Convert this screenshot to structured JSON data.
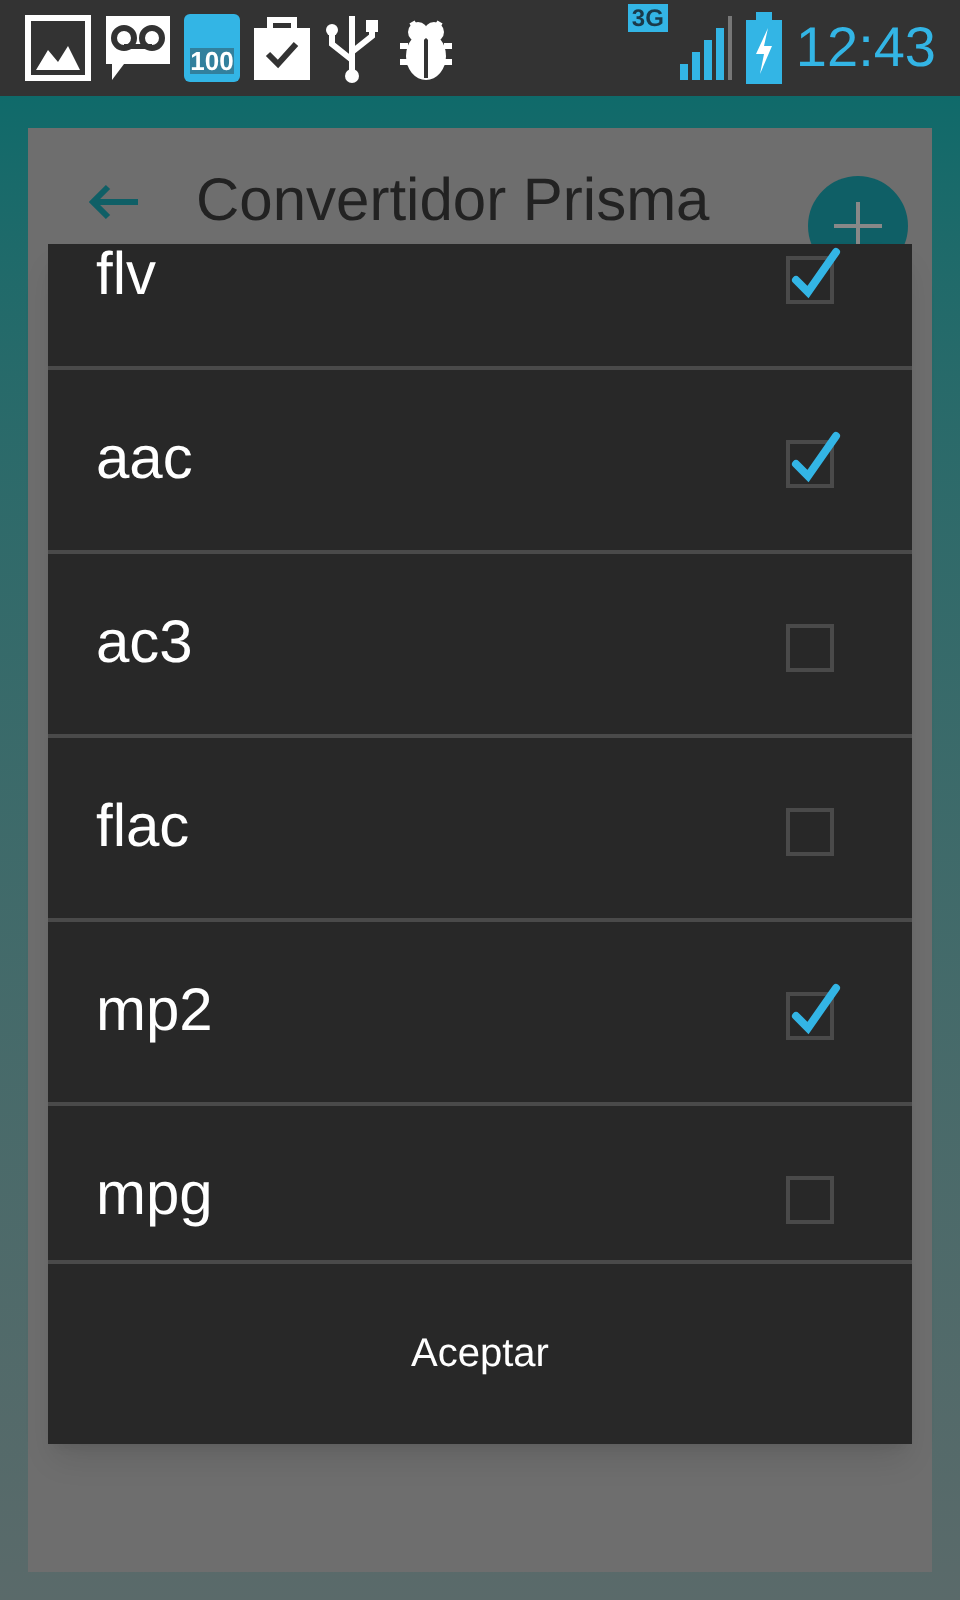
{
  "status_bar": {
    "battery_badge": "100",
    "network": "3G",
    "time": "12:43"
  },
  "app_bar": {
    "title": "Convertidor Prisma"
  },
  "dialog": {
    "items": [
      {
        "label": "flv",
        "checked": true
      },
      {
        "label": "aac",
        "checked": true
      },
      {
        "label": "ac3",
        "checked": false
      },
      {
        "label": "flac",
        "checked": false
      },
      {
        "label": "mp2",
        "checked": true
      },
      {
        "label": "mpg",
        "checked": false
      }
    ],
    "button": "Aceptar"
  }
}
